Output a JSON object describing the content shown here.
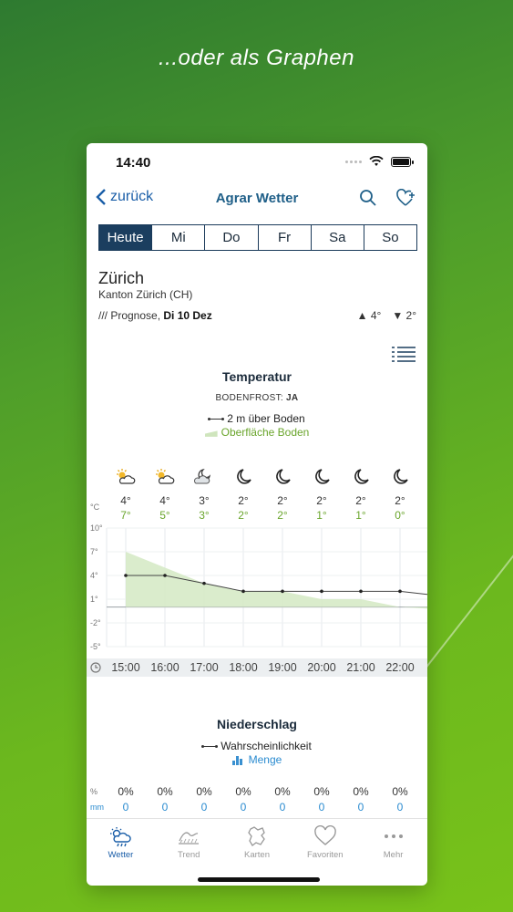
{
  "headline": "...oder als Graphen",
  "status": {
    "time": "14:40"
  },
  "nav": {
    "back_label": "zurück",
    "title": "Agrar Wetter"
  },
  "days": [
    "Heute",
    "Mi",
    "Do",
    "Fr",
    "Sa",
    "So"
  ],
  "location": {
    "name": "Zürich",
    "region": "Kanton Zürich (CH)",
    "forecast_prefix": "/// Prognose, ",
    "forecast_date": "Di 10 Dez",
    "max": "▲ 4°",
    "min": "▼ 2°"
  },
  "temperature": {
    "title": "Temperatur",
    "frost_label": "BODENFROST: ",
    "frost_value": "JA",
    "legend_air": "2 m über Boden",
    "legend_ground": "Oberfläche Boden",
    "unit": "°C",
    "y_ticks": [
      "10°",
      "7°",
      "4°",
      "1°",
      "-2°",
      "-5°"
    ],
    "icons": [
      "sun-cloud-icon",
      "sun-cloud-icon",
      "moon-cloud-icon",
      "moon-icon",
      "moon-icon",
      "moon-icon",
      "moon-icon",
      "moon-icon"
    ],
    "air_labels": [
      "4°",
      "4°",
      "3°",
      "2°",
      "2°",
      "2°",
      "2°",
      "2°"
    ],
    "ground_labels": [
      "7°",
      "5°",
      "3°",
      "2°",
      "2°",
      "1°",
      "1°",
      "0°"
    ]
  },
  "chart_data": {
    "type": "line",
    "title": "Temperatur",
    "xlabel": "",
    "ylabel": "°C",
    "ylim": [
      -5,
      10
    ],
    "categories": [
      "15:00",
      "16:00",
      "17:00",
      "18:00",
      "19:00",
      "20:00",
      "21:00",
      "22:00"
    ],
    "series": [
      {
        "name": "2 m über Boden",
        "kind": "line",
        "values": [
          4,
          4,
          3,
          2,
          2,
          2,
          2,
          2
        ]
      },
      {
        "name": "Oberfläche Boden",
        "kind": "area",
        "values": [
          7,
          5,
          3,
          2,
          2,
          1,
          1,
          0
        ]
      }
    ]
  },
  "time_labels": [
    "15:00",
    "16:00",
    "17:00",
    "18:00",
    "19:00",
    "20:00",
    "21:00",
    "22:00"
  ],
  "precipitation": {
    "title": "Niederschlag",
    "legend_prob": "Wahrscheinlichkeit",
    "legend_amount": "Menge",
    "unit_pct": "%",
    "unit_mm": "mm",
    "prob": [
      "0%",
      "0%",
      "0%",
      "0%",
      "0%",
      "0%",
      "0%",
      "0%"
    ],
    "amount": [
      "0",
      "0",
      "0",
      "0",
      "0",
      "0",
      "0",
      "0"
    ]
  },
  "tabs": [
    {
      "label": "Wetter",
      "icon": "weather-icon",
      "active": true
    },
    {
      "label": "Trend",
      "icon": "trend-icon",
      "active": false
    },
    {
      "label": "Karten",
      "icon": "map-icon",
      "active": false
    },
    {
      "label": "Favoriten",
      "icon": "heart-icon",
      "active": false
    },
    {
      "label": "Mehr",
      "icon": "more-icon",
      "active": false
    }
  ],
  "colors": {
    "accent": "#1a5ea8",
    "title": "#1f5f88",
    "ground": "#6aa52c",
    "rain": "#2a8bd0",
    "selected_day": "#1b3e5f"
  }
}
